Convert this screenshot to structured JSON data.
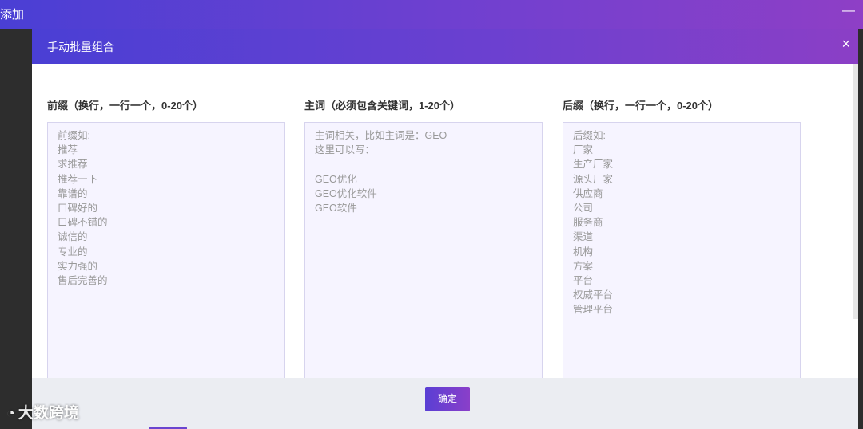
{
  "window": {
    "title": "添加",
    "minimize_label": "—"
  },
  "dialog": {
    "title": "手动批量组合",
    "close_label": "×",
    "columns": [
      {
        "label": "前缀（换行，一行一个，0-20个）",
        "placeholder": "前缀如:\n推荐\n求推荐\n推荐一下\n靠谱的\n口碑好的\n口碑不错的\n诚信的\n专业的\n实力强的\n售后完善的"
      },
      {
        "label": "主词（必须包含关键词，1-20个）",
        "placeholder": "主词相关，比如主词是：GEO\n这里可以写：\n\nGEO优化\nGEO优化软件\nGEO软件"
      },
      {
        "label": "后缀（换行，一行一个，0-20个）",
        "placeholder": "后缀如:\n厂家\n生产厂家\n源头厂家\n供应商\n公司\n服务商\n渠道\n机构\n方案\n平台\n权威平台\n管理平台"
      }
    ],
    "confirm_label": "确定"
  },
  "watermark": {
    "text": "大数跨境"
  },
  "colors": {
    "accent_start": "#4a3fd4",
    "accent_end": "#8e3fc6",
    "input_bg": "#f6f4ff"
  }
}
